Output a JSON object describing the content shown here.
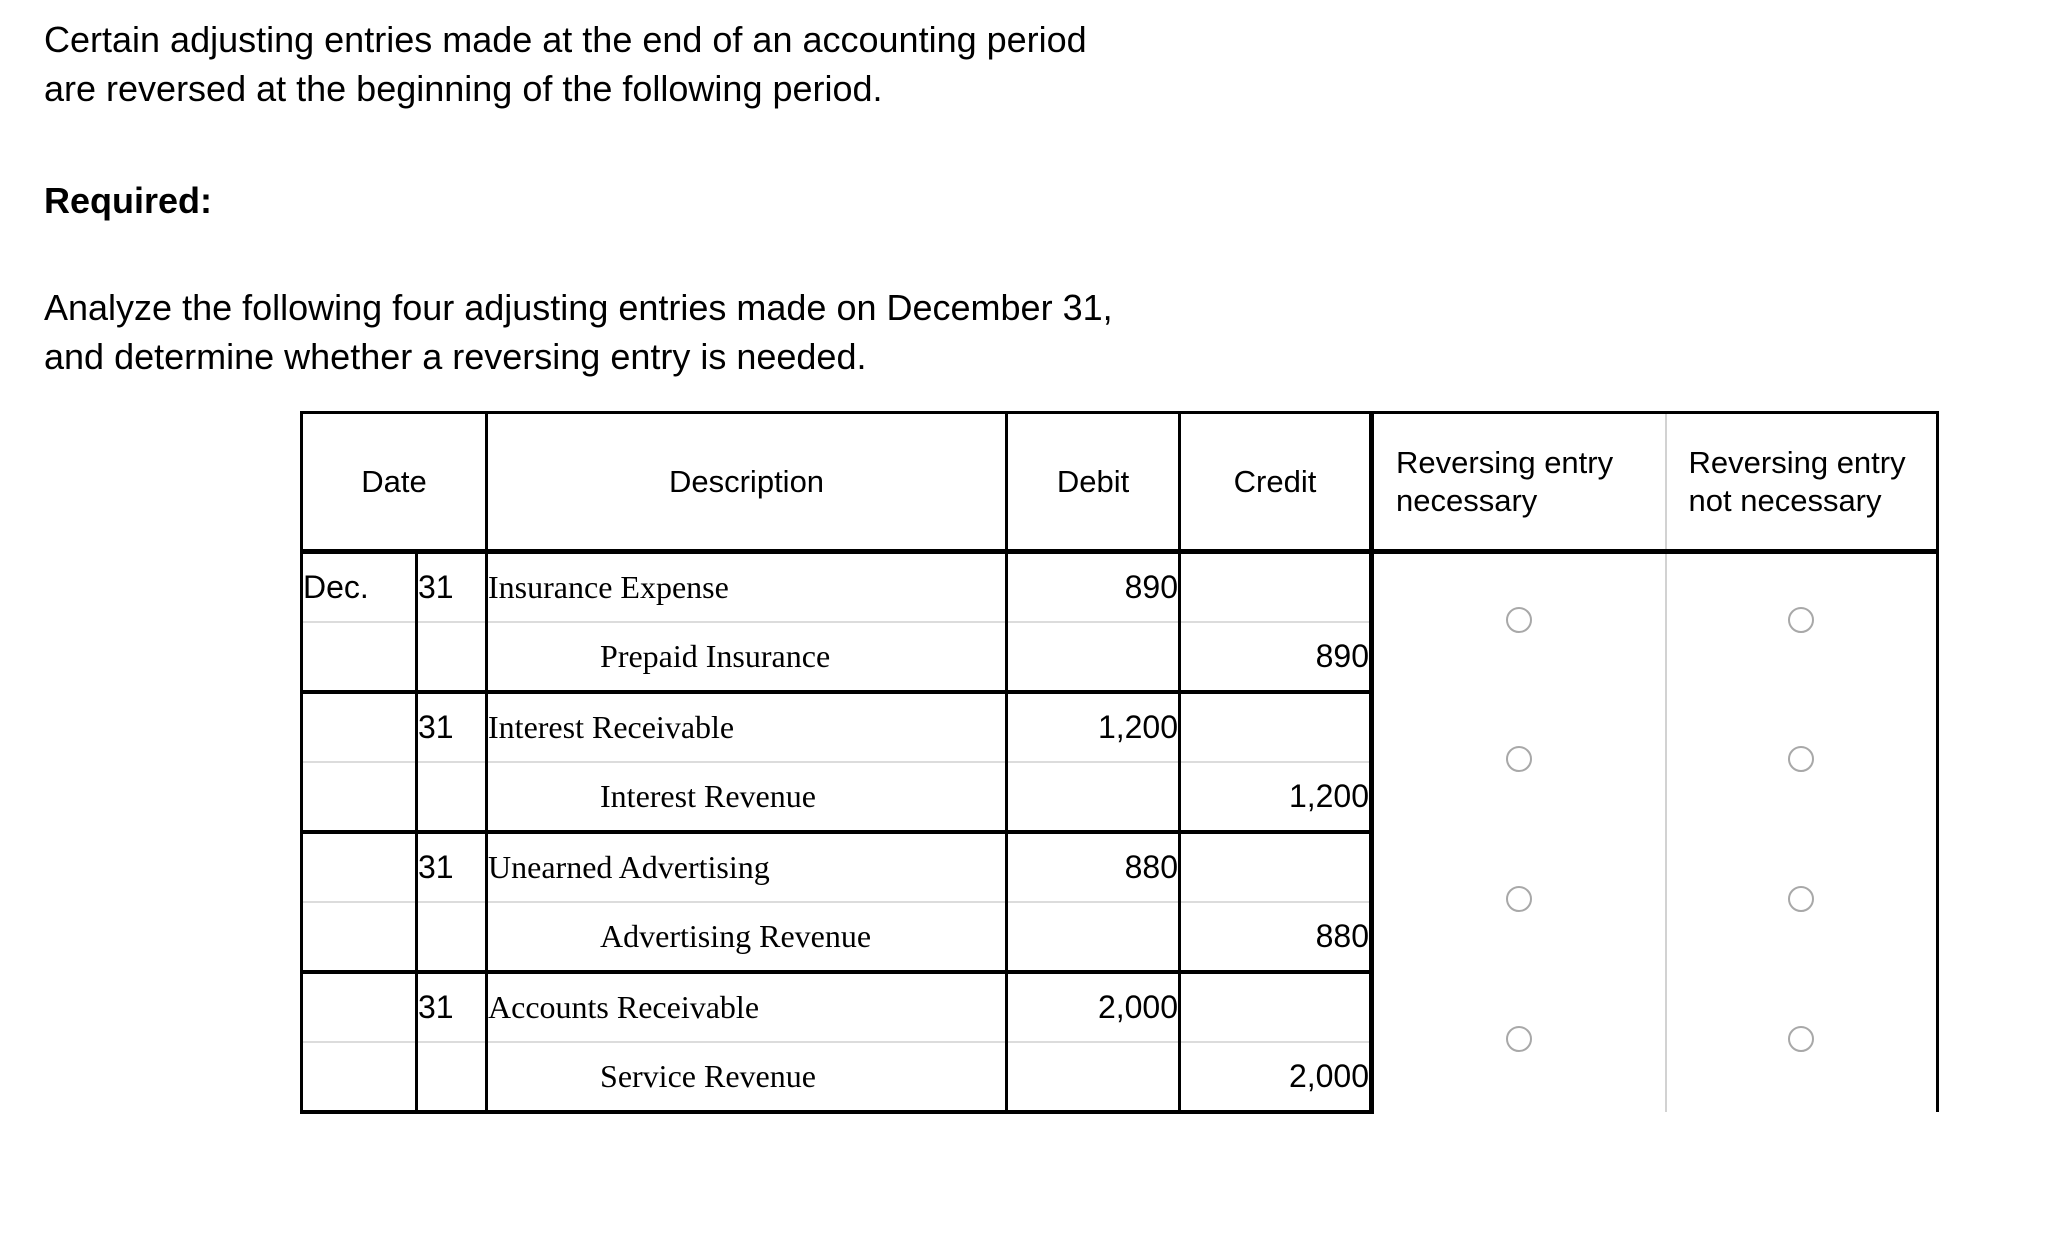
{
  "intro": {
    "paragraph": "Certain adjusting entries made at the end of an accounting period\nare reversed at the beginning of the following period.",
    "required_label": "Required:",
    "task": "Analyze the following four adjusting entries made on December 31,\nand determine whether a reversing entry is needed."
  },
  "table": {
    "headers": {
      "date": "Date",
      "description": "Description",
      "debit": "Debit",
      "credit": "Credit",
      "reversing_necessary": "Reversing entry\nnecessary",
      "reversing_not_necessary": "Reversing entry\nnot necessary"
    },
    "entries": [
      {
        "month": "Dec.",
        "day": "31",
        "debit_account": "Insurance Expense",
        "debit_amount": "890",
        "credit_account": "Prepaid Insurance",
        "credit_amount": "890",
        "reversing_necessary_selected": false,
        "reversing_not_necessary_selected": false
      },
      {
        "month": "",
        "day": "31",
        "debit_account": "Interest Receivable",
        "debit_amount": "1,200",
        "credit_account": "Interest Revenue",
        "credit_amount": "1,200",
        "reversing_necessary_selected": false,
        "reversing_not_necessary_selected": false
      },
      {
        "month": "",
        "day": "31",
        "debit_account": "Unearned Advertising",
        "debit_amount": "880",
        "credit_account": "Advertising Revenue",
        "credit_amount": "880",
        "reversing_necessary_selected": false,
        "reversing_not_necessary_selected": false
      },
      {
        "month": "",
        "day": "31",
        "debit_account": "Accounts Receivable",
        "debit_amount": "2,000",
        "credit_account": "Service Revenue",
        "credit_amount": "2,000",
        "reversing_necessary_selected": false,
        "reversing_not_necessary_selected": false
      }
    ]
  },
  "colors": {
    "text": "#000000",
    "background": "#ffffff",
    "rule_strong": "#000000",
    "rule_light": "#dcdcdc",
    "radio_border": "#a8a8a8"
  }
}
